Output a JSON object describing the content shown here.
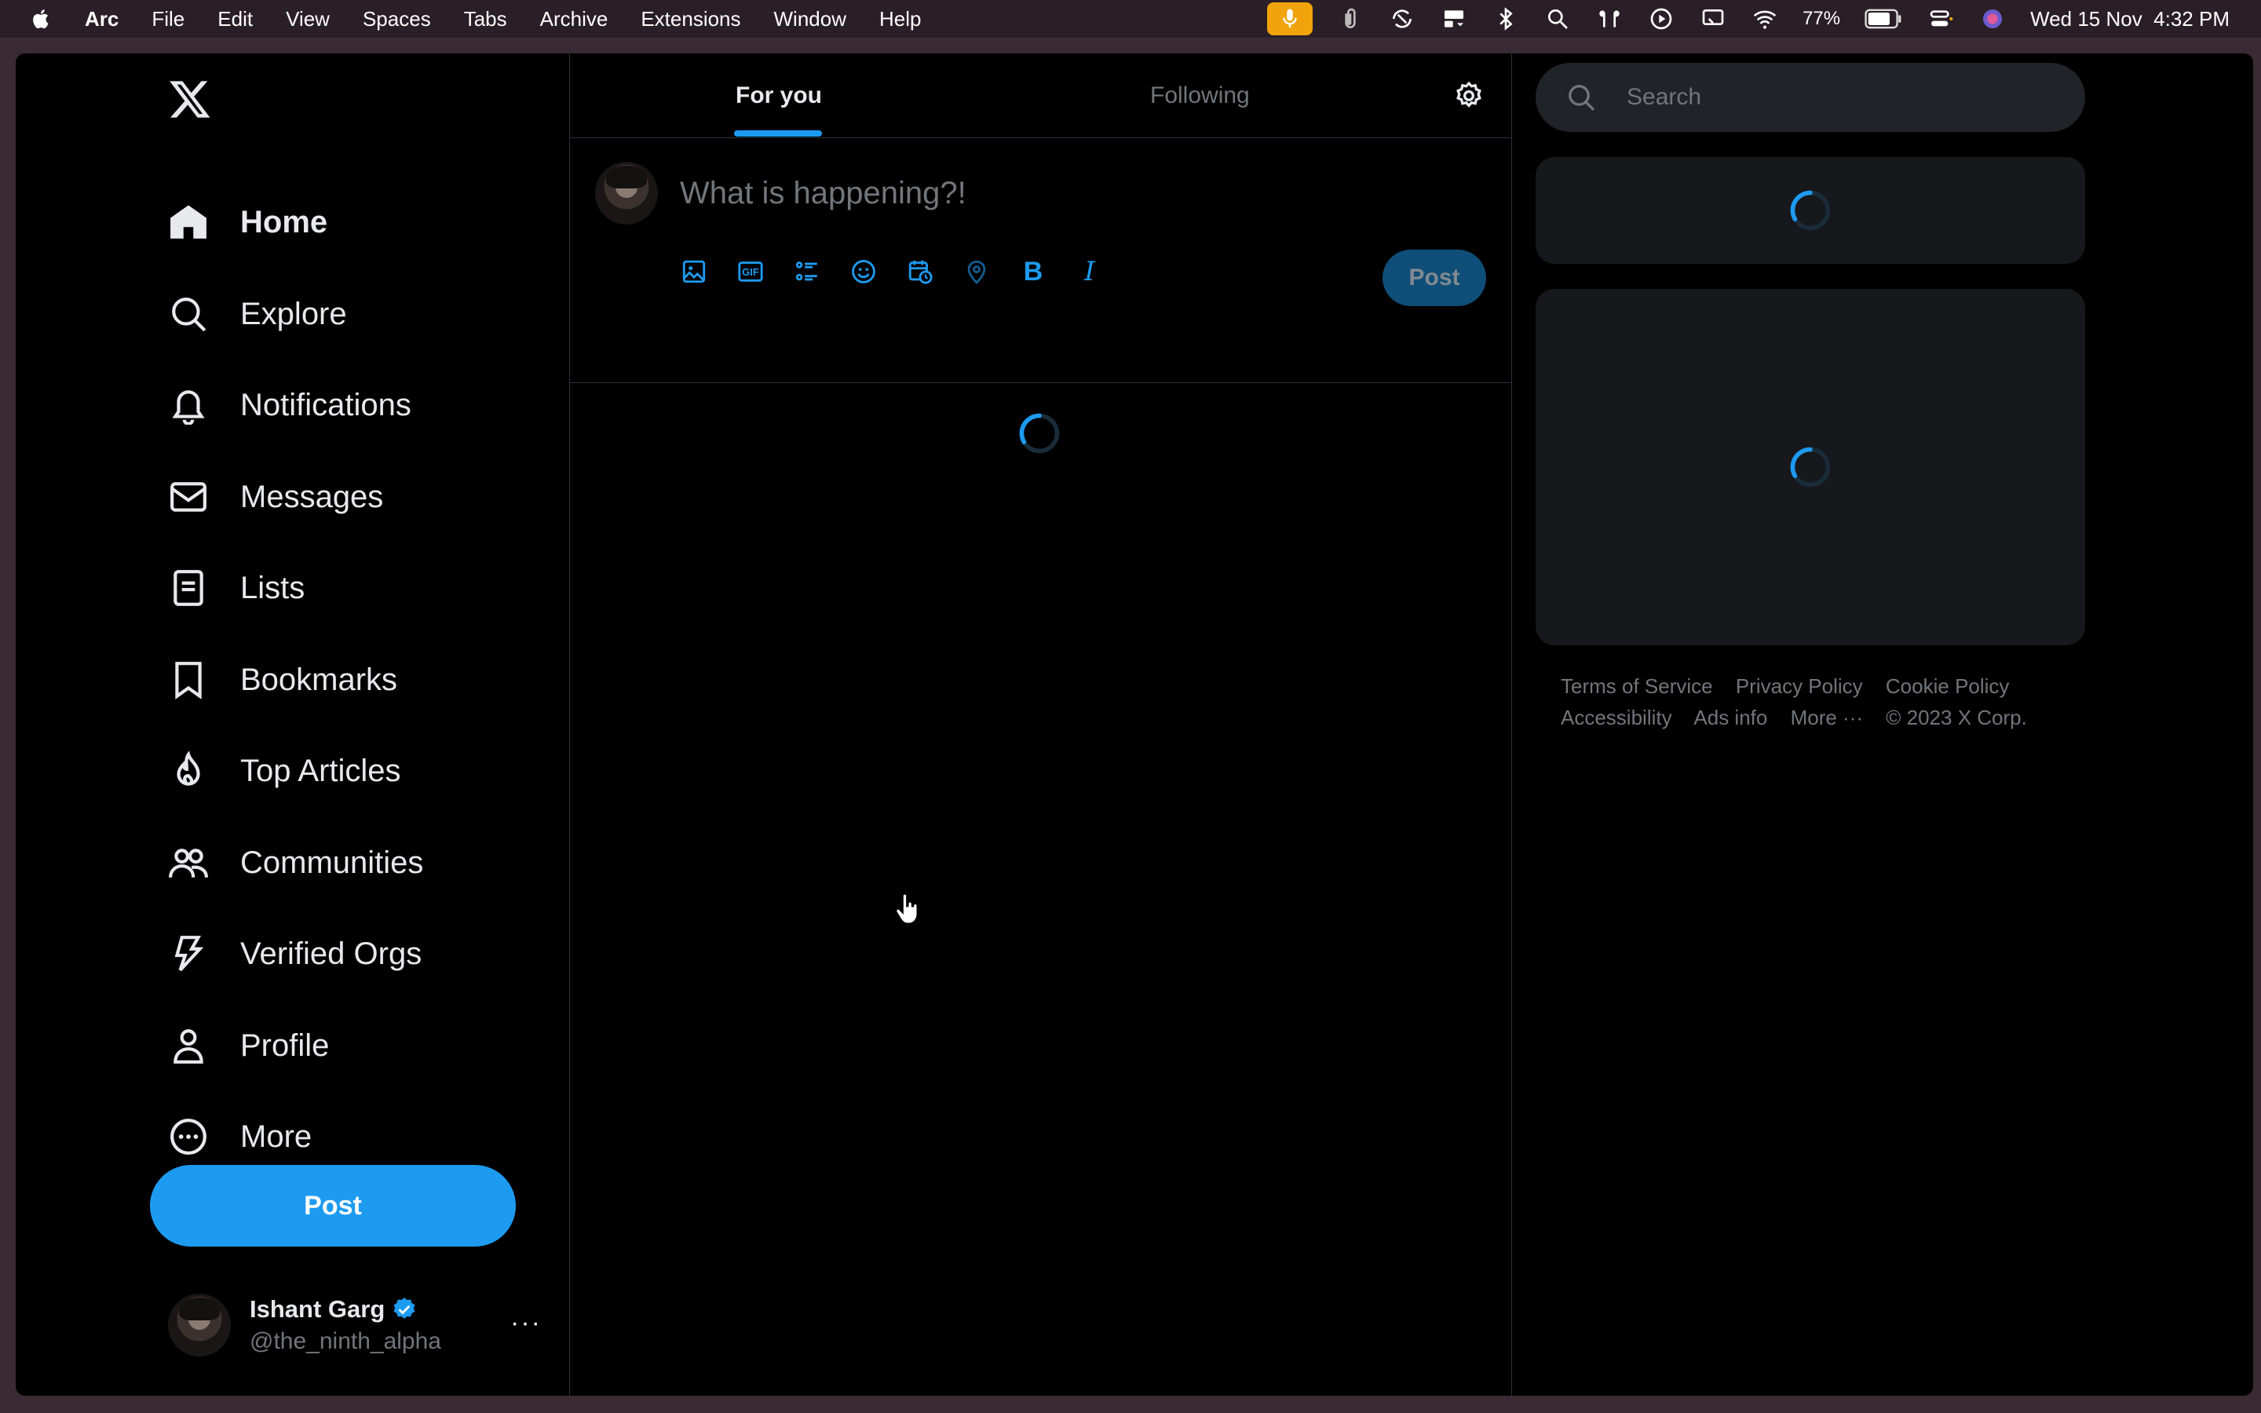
{
  "menubar": {
    "app_name": "Arc",
    "menus": [
      "File",
      "Edit",
      "View",
      "Spaces",
      "Tabs",
      "Archive",
      "Extensions",
      "Window",
      "Help"
    ],
    "battery": "77%",
    "datetime": "Wed 15 Nov  4:32 PM",
    "mic_color": "#f0a30a"
  },
  "nav": {
    "items": [
      {
        "label": "Home",
        "icon": "home-icon"
      },
      {
        "label": "Explore",
        "icon": "search-icon"
      },
      {
        "label": "Notifications",
        "icon": "bell-icon"
      },
      {
        "label": "Messages",
        "icon": "mail-icon"
      },
      {
        "label": "Lists",
        "icon": "list-icon"
      },
      {
        "label": "Bookmarks",
        "icon": "bookmark-icon"
      },
      {
        "label": "Top Articles",
        "icon": "flame-icon"
      },
      {
        "label": "Communities",
        "icon": "communities-icon"
      },
      {
        "label": "Verified Orgs",
        "icon": "lightning-icon"
      },
      {
        "label": "Profile",
        "icon": "person-icon"
      },
      {
        "label": "More",
        "icon": "more-circle-icon"
      }
    ],
    "post_label": "Post"
  },
  "account": {
    "name": "Ishant Garg",
    "handle": "@the_ninth_alpha",
    "more": "···"
  },
  "center": {
    "tabs": [
      "For you",
      "Following"
    ],
    "composer_placeholder": "What is happening?!",
    "post_label": "Post",
    "tools": [
      "image-icon",
      "gif-icon",
      "poll-icon",
      "emoji-icon",
      "schedule-icon",
      "location-icon",
      "bold-icon",
      "italic-icon"
    ],
    "gif_text": "GIF",
    "bold_text": "B",
    "italic_text": "I"
  },
  "right": {
    "search_placeholder": "Search",
    "footer": {
      "links_row1": [
        "Terms of Service",
        "Privacy Policy",
        "Cookie Policy"
      ],
      "links_row2": [
        "Accessibility",
        "Ads info",
        "More ···",
        "© 2023 X Corp."
      ]
    }
  },
  "colors": {
    "accent": "#1d9bf0",
    "background": "#000000",
    "muted_text": "#71767b",
    "border": "#2f3336",
    "card_bg": "#16181c"
  }
}
